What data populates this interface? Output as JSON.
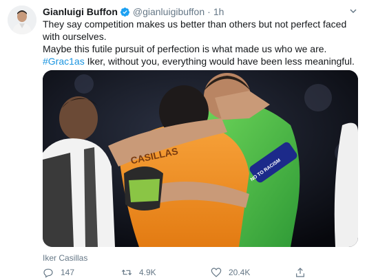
{
  "tweet": {
    "author_name": "Gianluigi Buffon",
    "handle": "@gianluigibuffon",
    "separator": "·",
    "time": "1h",
    "text_line1": "They say competition makes us better than others but not perfect faced with ourselves.",
    "text_line2": "Maybe this futile pursuit of perfection is what made us who we are.",
    "hashtag": "#Grac1as",
    "text_line3_rest": " Iker, without you, everything would have been less meaningful.",
    "media_caption": "Iker Casillas",
    "photo_jersey_name": "CASILLAS",
    "photo_armband_text": "NO TO RACISM"
  },
  "actions": {
    "reply_count": "147",
    "retweet_count": "4.9K",
    "like_count": "20.4K"
  },
  "icons": {
    "verified": "verified-badge-icon",
    "caret": "chevron-down-icon",
    "reply": "reply-icon",
    "retweet": "retweet-icon",
    "like": "heart-icon",
    "share": "share-icon"
  },
  "colors": {
    "accent": "#1b95e0",
    "text_primary": "#14171a",
    "text_secondary": "#657786"
  }
}
